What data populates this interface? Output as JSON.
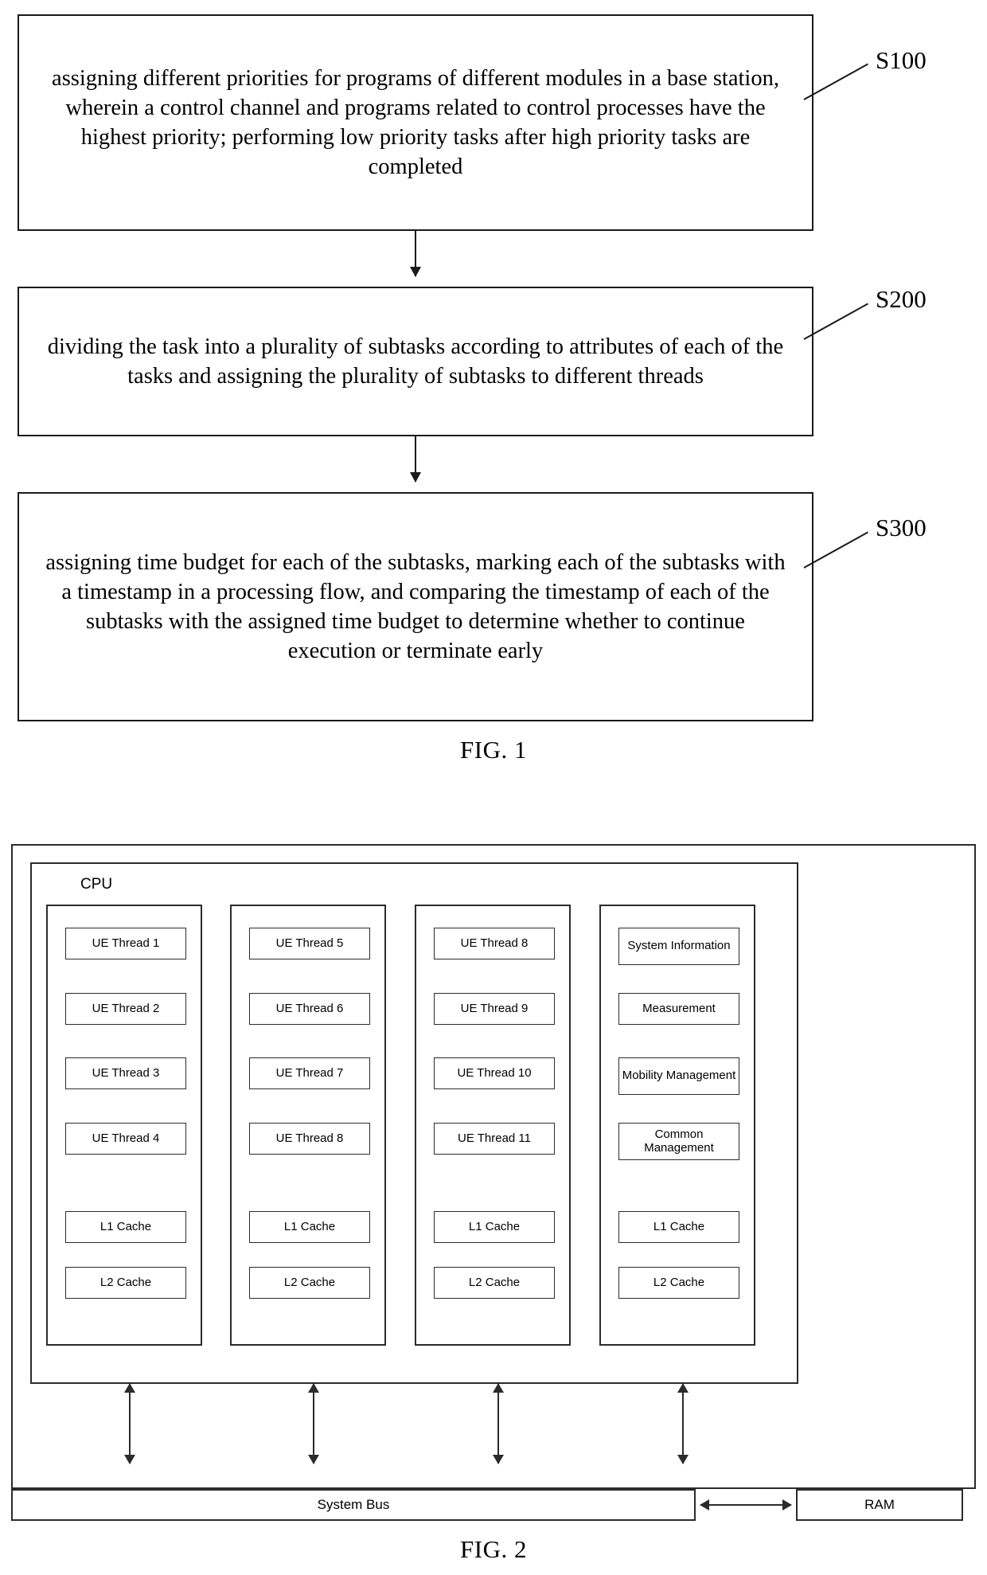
{
  "figure1": {
    "caption": "FIG. 1",
    "steps": [
      {
        "label": "S100",
        "text": "assigning different priorities for programs of different modules in a base station, wherein a control channel and programs related to control processes have the highest priority; performing low priority tasks after high priority tasks are completed"
      },
      {
        "label": "S200",
        "text": "dividing the task into a plurality of subtasks according to attributes of each of the tasks and assigning the plurality of subtasks to different threads"
      },
      {
        "label": "S300",
        "text": "assigning time budget for each of the subtasks, marking each of the subtasks with a timestamp in a processing flow, and comparing the timestamp of each of the subtasks with the assigned time budget to determine whether to continue execution or terminate early"
      }
    ]
  },
  "figure2": {
    "caption": "FIG. 2",
    "cpu_label": "CPU",
    "system_bus_label": "System Bus",
    "ram_label": "RAM",
    "cores": [
      {
        "threads": [
          "UE Thread 1",
          "UE Thread 2",
          "UE Thread 3",
          "UE Thread 4"
        ],
        "caches": [
          "L1 Cache",
          "L2 Cache"
        ]
      },
      {
        "threads": [
          "UE Thread 5",
          "UE Thread 6",
          "UE Thread 7",
          "UE Thread 8"
        ],
        "caches": [
          "L1 Cache",
          "L2 Cache"
        ]
      },
      {
        "threads": [
          "UE Thread 8",
          "UE Thread 9",
          "UE Thread 10",
          "UE Thread 11"
        ],
        "caches": [
          "L1 Cache",
          "L2 Cache"
        ]
      },
      {
        "threads": [
          "System Information",
          "Measurement",
          "Mobility Management",
          "Common Management"
        ],
        "caches": [
          "L1 Cache",
          "L2 Cache"
        ]
      }
    ]
  }
}
